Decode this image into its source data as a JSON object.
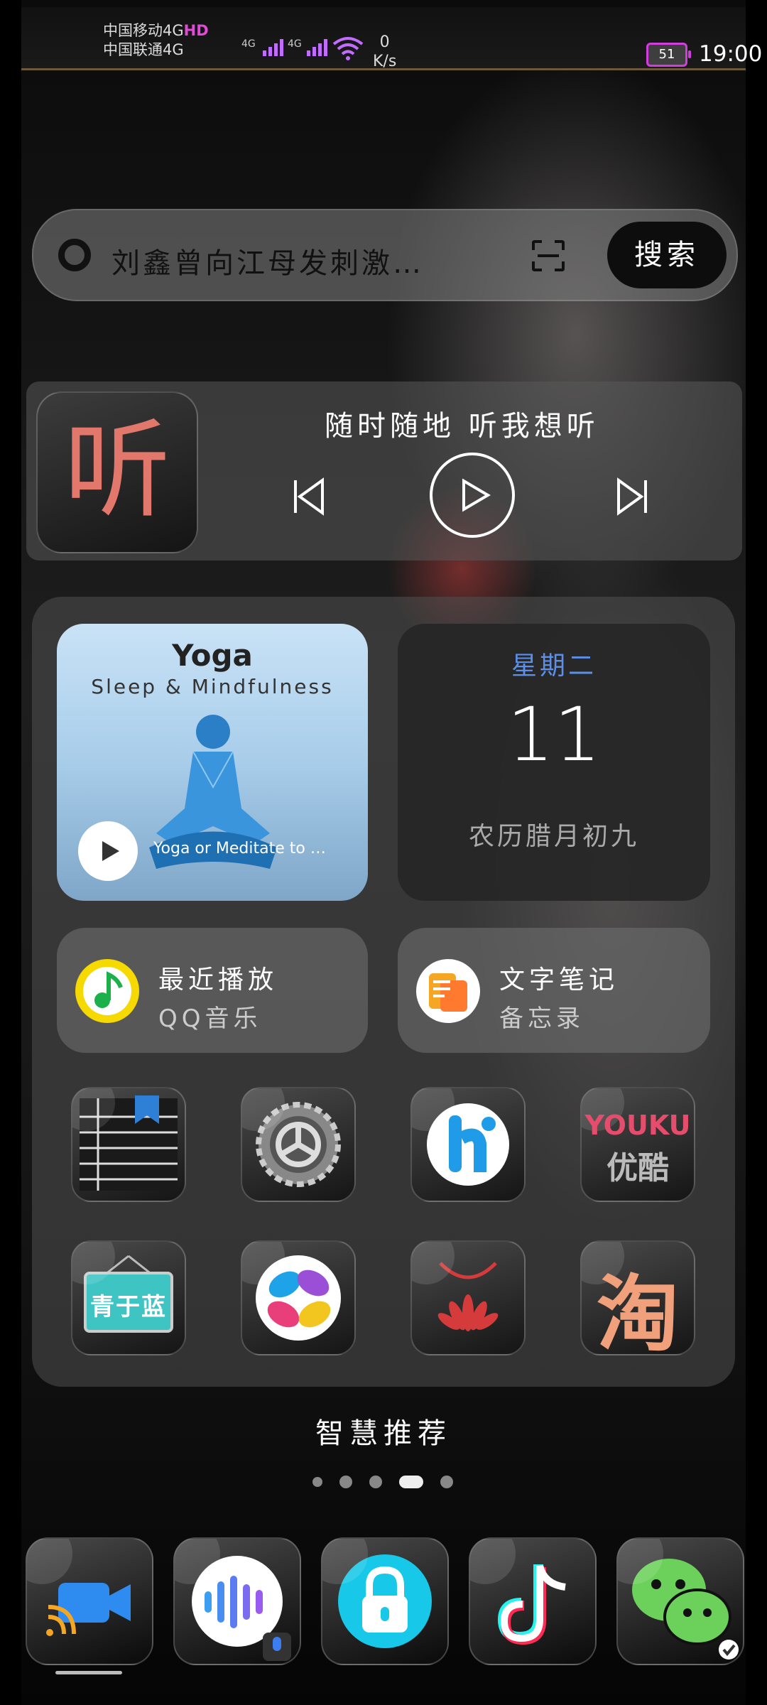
{
  "status_bar": {
    "carrier1": "中国移动4G",
    "carrier1_hd": "HD",
    "carrier2": "中国联通4G",
    "net1": "4G",
    "net2": "4G",
    "speed_value": "0",
    "speed_unit": "K/s",
    "battery": "51",
    "time": "19:00"
  },
  "search": {
    "query": "刘鑫曾向江母发刺激…",
    "button": "搜索"
  },
  "music_widget": {
    "app_glyph": "听",
    "title": "随时随地 听我想听"
  },
  "yoga_card": {
    "title": "Yoga",
    "subtitle": "Sleep & Mindfulness",
    "caption": "Yoga or Meditate to …"
  },
  "calendar": {
    "weekday": "星期二",
    "day": "11",
    "lunar": "农历腊月初九"
  },
  "qq_music": {
    "line1": "最近播放",
    "line2": "QQ音乐"
  },
  "memo": {
    "line1": "文字笔记",
    "line2": "备忘录"
  },
  "apps_row1": [
    "notes-icon",
    "settings-icon",
    "hi-app-icon",
    "youku-icon"
  ],
  "apps_row2": [
    "qingting-icon",
    "gallery-icon",
    "huawei-store-icon",
    "taobao-icon"
  ],
  "youku_label": {
    "top": "YOUKU",
    "bottom": "优酷"
  },
  "qingting_label": "青于蓝",
  "taobao_label": "淘",
  "smart_label": "智慧推荐",
  "pager": {
    "count": 5,
    "active": 3
  },
  "dock": [
    "projection-icon",
    "voice-assistant-icon",
    "lock-icon",
    "tiktok-icon",
    "wechat-icon"
  ],
  "colors": {
    "accent_blue": "#5b8fe8",
    "wechat_green": "#6bd15a",
    "qq_yellow": "#f5d900"
  }
}
